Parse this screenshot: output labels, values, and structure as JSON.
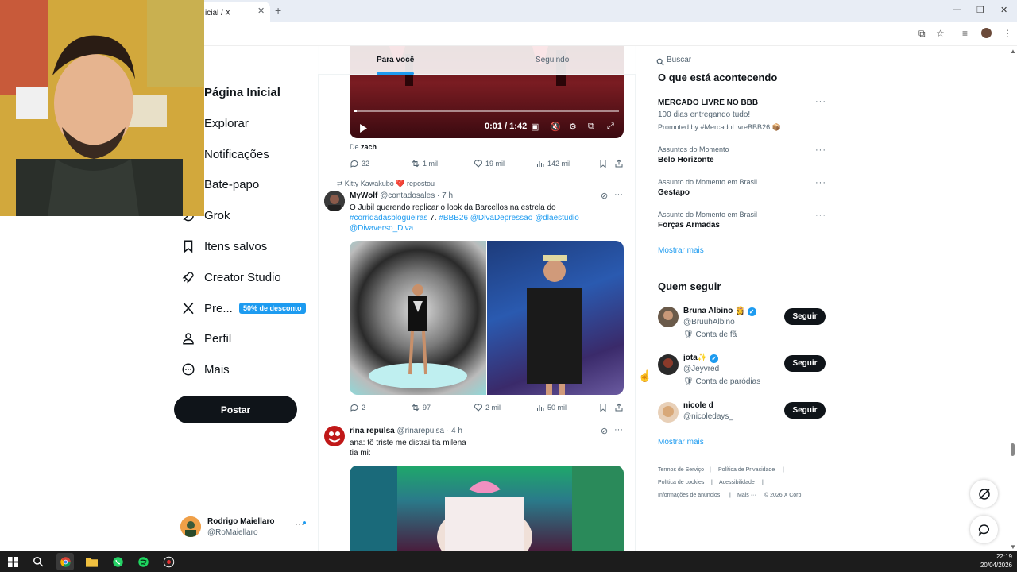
{
  "browser": {
    "tab_title": "icial / X",
    "tab_close": "✕",
    "new_tab": "+",
    "min": "—",
    "max": "❐",
    "close": "✕"
  },
  "nav": {
    "home": "Página Inicial",
    "explore": "Explorar",
    "notifications": "Notificações",
    "chat": "Bate-papo",
    "grok": "Grok",
    "bookmarks": "Itens salvos",
    "creator_studio": "Creator Studio",
    "premium": "Pre...",
    "premium_badge": "50% de desconto",
    "profile": "Perfil",
    "more": "Mais",
    "post_button": "Postar"
  },
  "account": {
    "name": "Rodrigo Maiellaro",
    "handle": "@RoMaiellaro",
    "more": "···"
  },
  "feed": {
    "tabs": [
      "Para você",
      "Seguindo"
    ],
    "video": {
      "time": "0:01 / 1:42",
      "from_prefix": "De",
      "from_name": "zach",
      "actions": {
        "replies": "32",
        "reposts": "1 mil",
        "likes": "19 mil",
        "views": "142 mil"
      }
    },
    "post1": {
      "repost_line": "Kitty Kawakubo 💔 repostou",
      "name": "MyWolf",
      "handle": "@contadosales",
      "time": "· 7 h",
      "text_1": "O Jubil querendo replicar o look da Barcellos na estrela do",
      "text_2_link": "#corridadasblogueiras",
      "text_2_plain": " 7. ",
      "text_2_links": "#BBB26 @DivaDepressao @dlaestudio",
      "text_3_link": "@Divaverso_Diva",
      "actions": {
        "replies": "2",
        "reposts": "97",
        "likes": "2 mil",
        "views": "50 mil"
      }
    },
    "post2": {
      "name": "rina repulsa",
      "handle": "@rinarepulsa",
      "time": "· 4 h",
      "text_1": "ana: tô triste me distrai tia milena",
      "text_2": "tia mi:"
    }
  },
  "right": {
    "search_placeholder": "Buscar",
    "trends_title": "O que está acontecendo",
    "trends": [
      {
        "main": "MERCADO LIVRE NO BBB",
        "sub": "100 dias entregando tudo!",
        "promo": "Promoted by #MercadoLivreBBB26 📦"
      },
      {
        "small": "Assuntos do Momento",
        "main": "Belo Horizonte"
      },
      {
        "small": "Assunto do Momento em Brasil",
        "main": "Gestapo"
      },
      {
        "small": "Assunto do Momento em Brasil",
        "main": "Forças Armadas"
      }
    ],
    "show_more": "Mostrar mais",
    "who_title": "Quem seguir",
    "who": [
      {
        "name": "Bruna Albino 👸",
        "handle": "@BruuhAlbino",
        "label": "Conta de fã",
        "button": "Seguir"
      },
      {
        "name": "jota✨",
        "handle": "@Jeyvred",
        "label": "Conta de paródias",
        "button": "Seguir"
      },
      {
        "name": "nicole d",
        "handle": "@nicoledays_",
        "button": "Seguir"
      }
    ],
    "who_show_more": "Mostrar mais",
    "footer": {
      "terms": "Termos de Serviço",
      "privacy": "Política de Privacidade",
      "cookies": "Política de cookies",
      "accessibility": "Acessibilidade",
      "ads": "Informações de anúncios",
      "more": "Mais ···",
      "copyright": "© 2026 X Corp."
    }
  },
  "taskbar": {
    "time": "22:19",
    "date": "20/04/2026"
  },
  "colors": {
    "accent": "#1d9bf0",
    "text": "#0f1419",
    "muted": "#536471"
  }
}
